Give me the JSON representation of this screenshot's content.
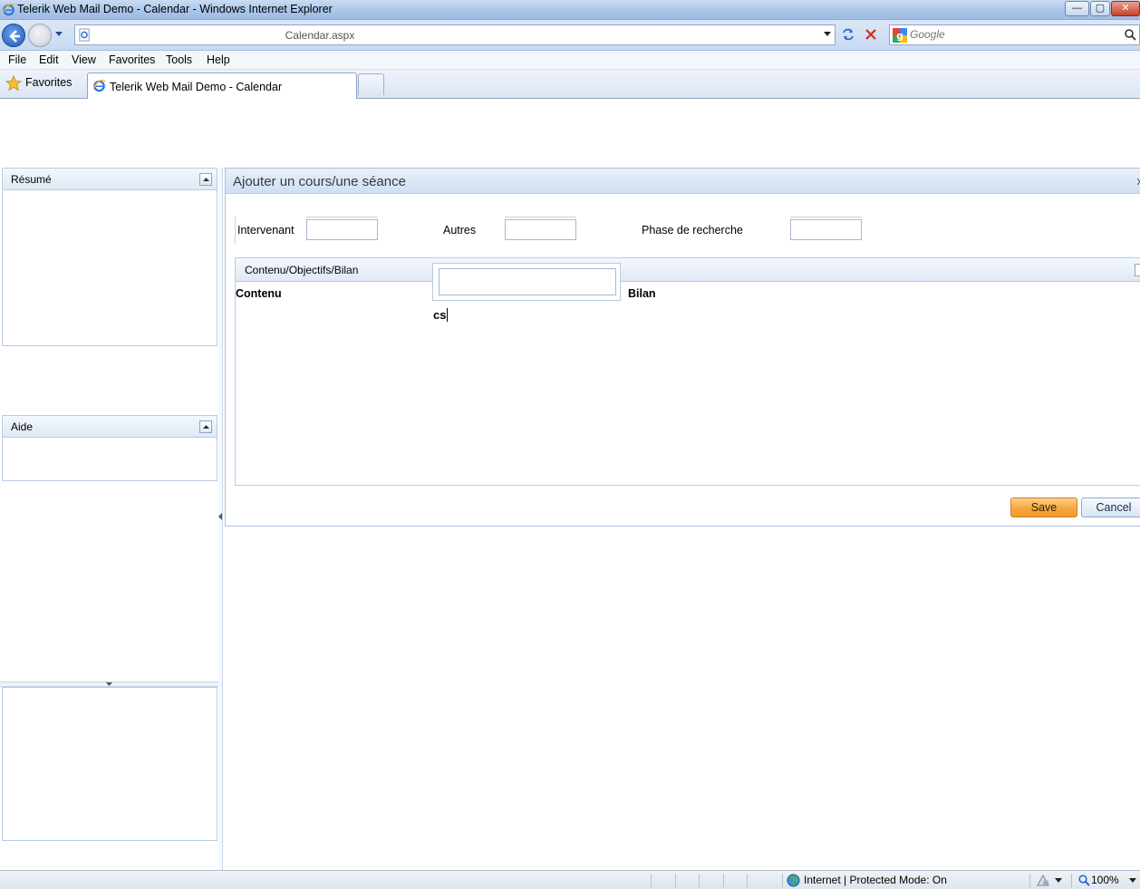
{
  "window": {
    "title": "Telerik Web Mail Demo - Calendar - Windows Internet Explorer",
    "controls": {
      "minimize": "—",
      "restore": "▢",
      "close": "✕"
    }
  },
  "addressbar": {
    "url": "Calendar.aspx",
    "search_placeholder": "Google"
  },
  "menu": [
    "File",
    "Edit",
    "View",
    "Favorites",
    "Tools",
    "Help"
  ],
  "favorites": {
    "label": "Favorites"
  },
  "tabs": [
    {
      "label": "Telerik Web Mail Demo - Calendar"
    }
  ],
  "left_pane": {
    "panels": [
      {
        "title": "Résumé"
      },
      {
        "title": "Aide"
      }
    ]
  },
  "dialog": {
    "title": "Ajouter un cours/une séance",
    "close": "x",
    "fields": [
      {
        "label": "Intervenant",
        "value": ""
      },
      {
        "label": "Autres",
        "value": ""
      },
      {
        "label": "Phase de recherche",
        "value": ""
      }
    ],
    "group": {
      "title": "Contenu/Objectifs/Bilan",
      "col_contenu": "Contenu",
      "col_bilan": "Bilan",
      "popup_value": "",
      "typed_text": "cs"
    },
    "buttons": {
      "save": "Save",
      "cancel": "Cancel"
    }
  },
  "statusbar": {
    "zone": "Internet | Protected Mode: On",
    "zoom": "100%"
  },
  "colors": {
    "save_button": "#f5a640",
    "panel_header": "#dfe9f5",
    "ie_blue": "#1f59b8"
  }
}
